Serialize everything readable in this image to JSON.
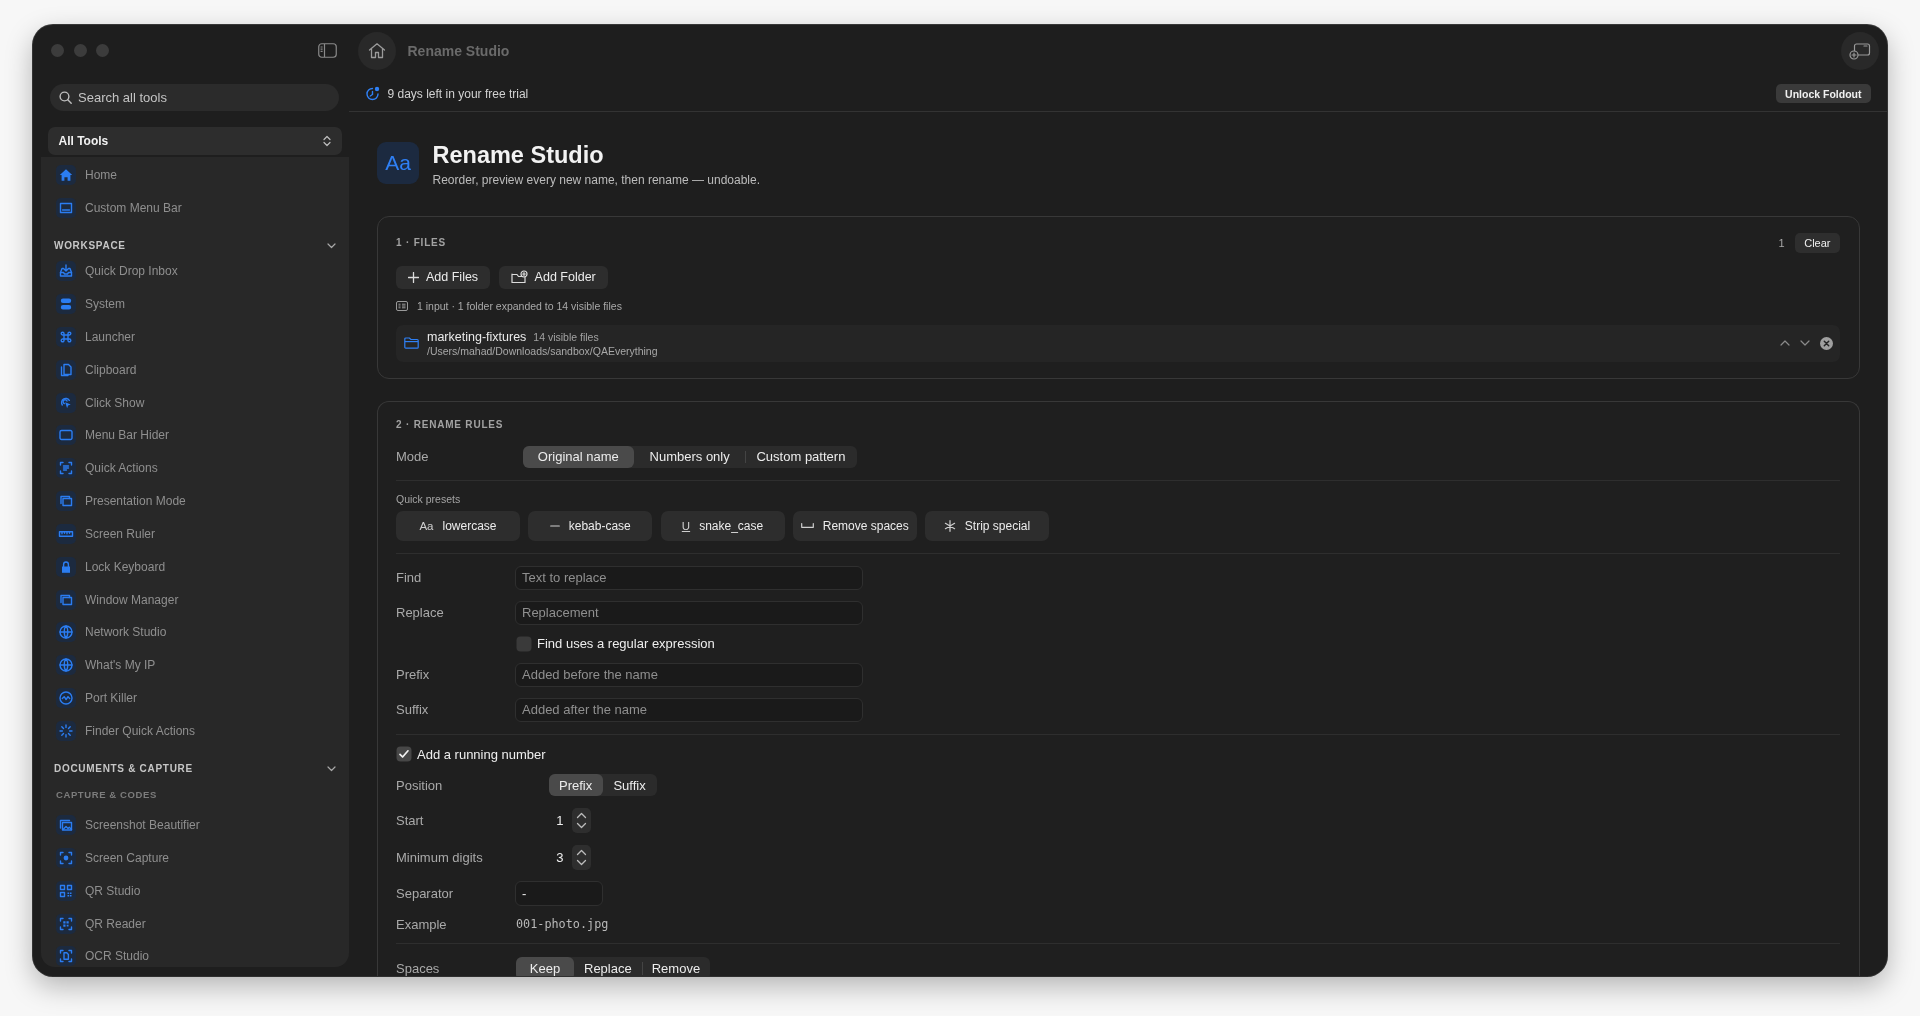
{
  "sidebar": {
    "search": {
      "placeholder": "Search all tools"
    },
    "scope": {
      "value": "All Tools"
    },
    "pinned": [
      {
        "label": "Home",
        "selected": false
      },
      {
        "label": "Custom Menu Bar",
        "selected": false
      }
    ],
    "sections": [
      {
        "title": "WORKSPACE",
        "expanded": true,
        "groups": [
          {
            "items": [
              {
                "label": "Quick Drop Inbox",
                "selected": false
              },
              {
                "label": "System",
                "selected": false
              },
              {
                "label": "Launcher",
                "selected": false
              },
              {
                "label": "Clipboard",
                "selected": false
              },
              {
                "label": "Click Show",
                "selected": false
              },
              {
                "label": "Menu Bar Hider",
                "selected": false
              },
              {
                "label": "Quick Actions",
                "selected": false
              },
              {
                "label": "Presentation Mode",
                "selected": false
              },
              {
                "label": "Screen Ruler",
                "selected": false
              },
              {
                "label": "Lock Keyboard",
                "selected": false
              },
              {
                "label": "Window Manager",
                "selected": false
              },
              {
                "label": "Network Studio",
                "selected": false
              },
              {
                "label": "What's My IP",
                "selected": false
              },
              {
                "label": "Port Killer",
                "selected": false
              },
              {
                "label": "Finder Quick Actions",
                "selected": false
              }
            ]
          }
        ]
      },
      {
        "title": "DOCUMENTS & CAPTURE",
        "expanded": true,
        "groups": [
          {
            "title": "CAPTURE & CODES",
            "items": [
              {
                "label": "Screenshot Beautifier",
                "selected": false
              },
              {
                "label": "Screen Capture",
                "selected": false
              },
              {
                "label": "QR Studio",
                "selected": false
              },
              {
                "label": "QR Reader",
                "selected": false
              },
              {
                "label": "OCR Studio",
                "selected": false
              }
            ]
          }
        ]
      }
    ]
  },
  "header": {
    "title": "Rename Studio"
  },
  "trial": {
    "text": "9 days left in your free trial",
    "action": "Unlock Foldout"
  },
  "page": {
    "logo": "Aa",
    "title": "Rename Studio",
    "subtitle": "Reorder, preview every new name, then rename — undoable."
  },
  "files": {
    "title": "1 · FILES",
    "count": "1",
    "clear": "Clear",
    "actions": [
      {
        "label": "Add Files"
      },
      {
        "label": "Add Folder"
      }
    ],
    "summary": "1 input · 1 folder expanded to 14 visible files",
    "entries": [
      {
        "name": "marketing-fixtures",
        "detail": "14 visible files",
        "path": "/Users/mahad/Downloads/sandbox/QAEverything"
      }
    ]
  },
  "rules": {
    "title": "2 · RENAME RULES",
    "mode": {
      "label": "Mode",
      "options": [
        {
          "label": "Original name",
          "selected": true
        },
        {
          "label": "Numbers only",
          "selected": false
        },
        {
          "label": "Custom pattern",
          "selected": false
        }
      ]
    },
    "presets": {
      "label": "Quick presets",
      "items": [
        {
          "label": "lowercase",
          "glyph": "Aa"
        },
        {
          "label": "kebab-case"
        },
        {
          "label": "snake_case",
          "glyph": "U"
        },
        {
          "label": "Remove spaces"
        },
        {
          "label": "Strip special"
        }
      ]
    },
    "rows": [
      {
        "kind": "field",
        "label": "Find",
        "placeholder": "Text to replace"
      },
      {
        "kind": "field",
        "label": "Replace",
        "placeholder": "Replacement"
      },
      {
        "kind": "checkbox",
        "label": "Find uses a regular expression",
        "checked": false
      },
      {
        "kind": "field",
        "label": "Prefix",
        "placeholder": "Added before the name"
      },
      {
        "kind": "field",
        "label": "Suffix",
        "placeholder": "Added after the name"
      }
    ],
    "numbering": {
      "label": "Add a running number",
      "checked": true,
      "position": {
        "label": "Position",
        "options": [
          {
            "label": "Prefix",
            "selected": true
          },
          {
            "label": "Suffix",
            "selected": false
          }
        ]
      },
      "start": {
        "label": "Start",
        "value": "1"
      },
      "digits": {
        "label": "Minimum digits",
        "value": "3"
      },
      "separator": {
        "label": "Separator",
        "value": "-"
      },
      "example": {
        "label": "Example",
        "value": "001-photo.jpg"
      }
    },
    "spaces": {
      "label": "Spaces",
      "options": [
        {
          "label": "Keep",
          "selected": true
        },
        {
          "label": "Replace",
          "selected": false
        },
        {
          "label": "Remove",
          "selected": false
        }
      ]
    }
  }
}
